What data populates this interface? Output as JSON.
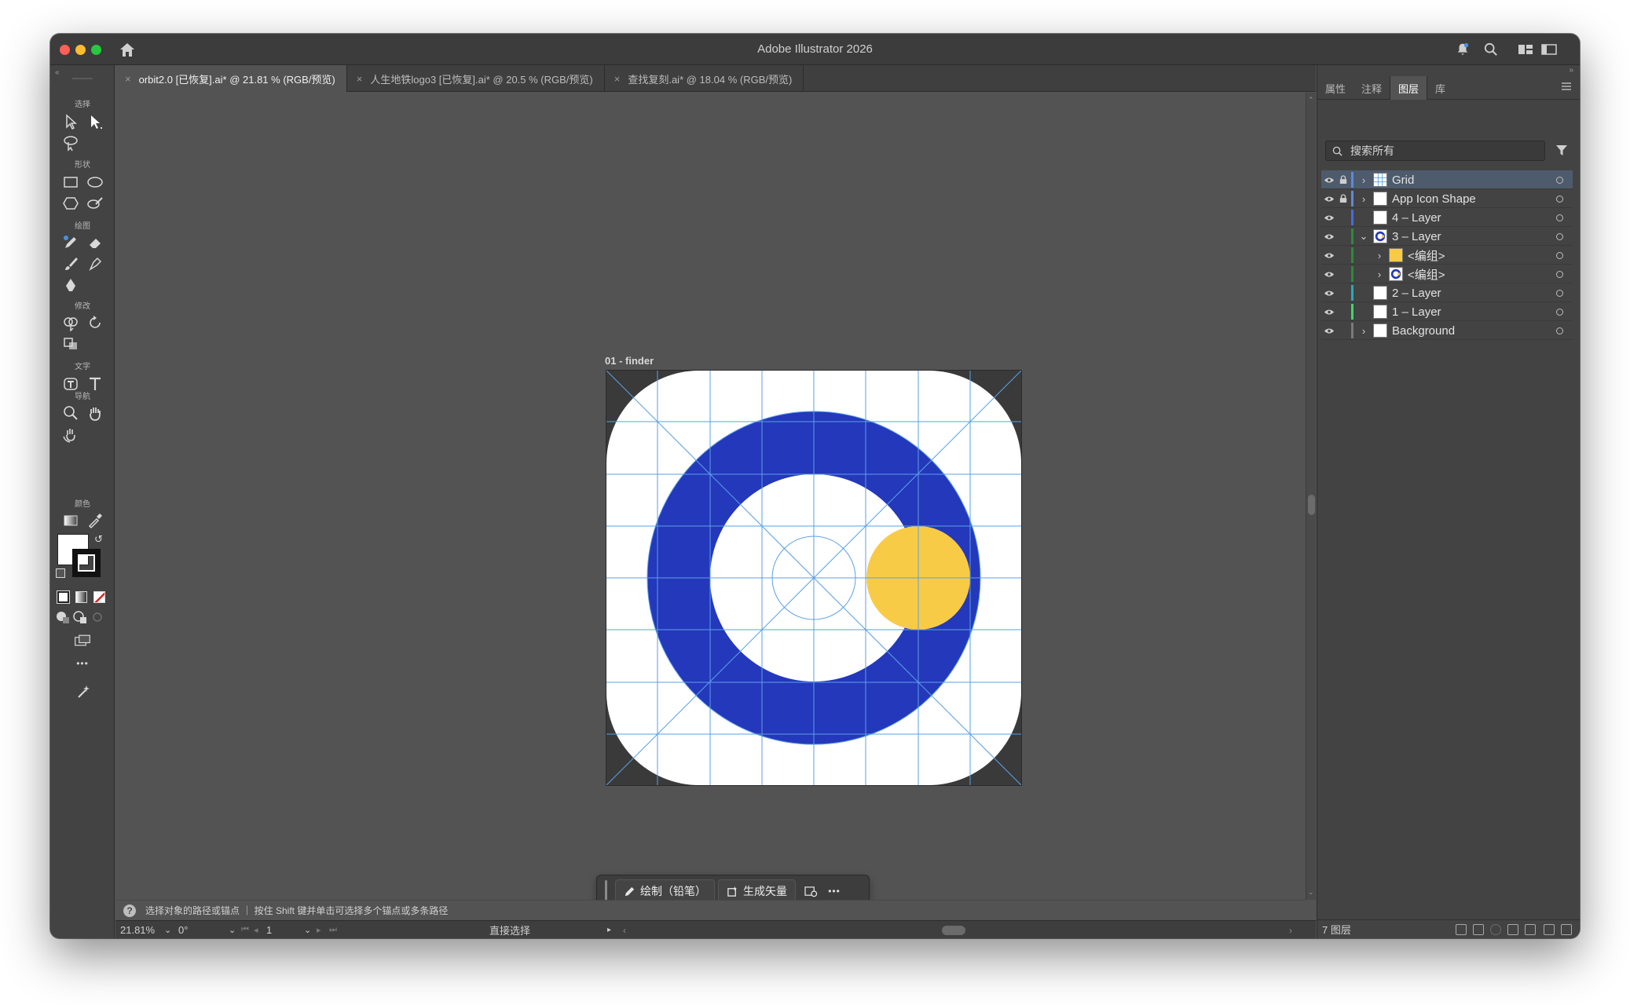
{
  "window": {
    "title": "Adobe Illustrator 2026"
  },
  "tabs": [
    {
      "label": "orbit2.0 [已恢复].ai* @ 21.81 % (RGB/预览)",
      "active": true
    },
    {
      "label": "人生地铁logo3 [已恢复].ai* @ 20.5 % (RGB/预览)",
      "active": false
    },
    {
      "label": "查找复刻.ai* @ 18.04 % (RGB/预览)",
      "active": false
    }
  ],
  "tab_close": "×",
  "toolbar": {
    "sections": [
      "选择",
      "形状",
      "绘图",
      "修改",
      "文字",
      "导航",
      "颜色"
    ],
    "more": "•••"
  },
  "artboard": {
    "label": "01 - finder",
    "colors": {
      "blue": "#2438bb",
      "yellow": "#f8cb47",
      "white": "#ffffff",
      "grid": "#5aa0e6",
      "dark": "#3a3a3a"
    }
  },
  "contextual_bar": {
    "draw_button": "绘制（铅笔）",
    "generate_button": "生成矢量",
    "more": "•••"
  },
  "status": {
    "message": "选择对象的路径或锚点 ｜ 按住 Shift 键并单击可选择多个锚点或多条路径",
    "zoom": "21.81%",
    "rotation": "0°",
    "artboard_number": "1",
    "tool_name": "直接选择"
  },
  "right_panel": {
    "tabs": [
      {
        "label": "属性",
        "active": false
      },
      {
        "label": "注释",
        "active": false
      },
      {
        "label": "图层",
        "active": true
      },
      {
        "label": "库",
        "active": false
      }
    ],
    "search_placeholder": "搜索所有",
    "layers": [
      {
        "name": "Grid",
        "selected": true,
        "locked": true,
        "expand": "›",
        "indent": 0,
        "bar": "#5d8ad6",
        "thumb": "grid"
      },
      {
        "name": "App Icon Shape",
        "selected": false,
        "locked": true,
        "expand": "›",
        "indent": 0,
        "bar": "#5d8ad6",
        "thumb": "white"
      },
      {
        "name": "4 – Layer",
        "selected": false,
        "locked": false,
        "expand": "",
        "indent": 0,
        "bar": "#3f6fe0",
        "thumb": "white"
      },
      {
        "name": "3 – Layer",
        "selected": false,
        "locked": false,
        "expand": "⌄",
        "indent": 0,
        "bar": "#2e8a3a",
        "thumb": "ring"
      },
      {
        "name": "<编组>",
        "selected": false,
        "locked": false,
        "expand": "›",
        "indent": 1,
        "bar": "#2e8a3a",
        "thumb": "yellow"
      },
      {
        "name": "<编组>",
        "selected": false,
        "locked": false,
        "expand": "›",
        "indent": 1,
        "bar": "#2e8a3a",
        "thumb": "ring"
      },
      {
        "name": "2 – Layer",
        "selected": false,
        "locked": false,
        "expand": "",
        "indent": 0,
        "bar": "#2aa7b8",
        "thumb": "white"
      },
      {
        "name": "1 – Layer",
        "selected": false,
        "locked": false,
        "expand": "",
        "indent": 0,
        "bar": "#3fd66b",
        "thumb": "white"
      },
      {
        "name": "Background",
        "selected": false,
        "locked": false,
        "expand": "›",
        "indent": 0,
        "bar": "#7a7a7a",
        "thumb": "white"
      }
    ],
    "layer_count": "7 图层"
  }
}
